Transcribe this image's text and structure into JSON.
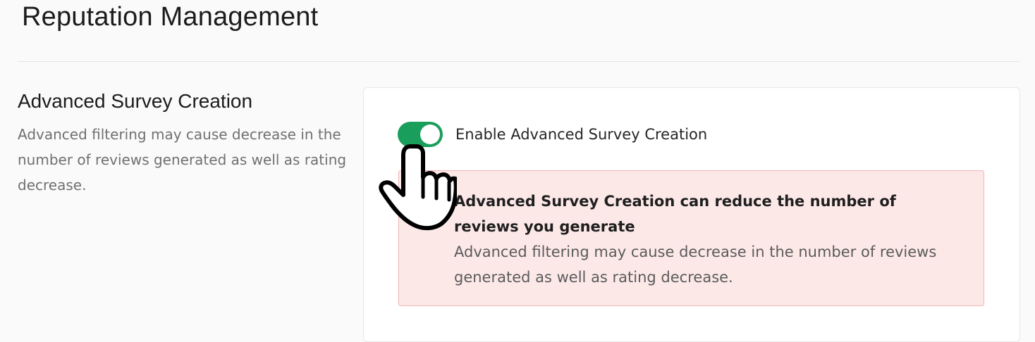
{
  "page": {
    "title": "Reputation Management"
  },
  "section": {
    "heading": "Advanced Survey Creation",
    "description": "Advanced filtering may cause decrease in the number of reviews generated as well as rating decrease."
  },
  "settings": {
    "toggle_label": "Enable Advanced Survey Creation",
    "toggle_on": true
  },
  "alert": {
    "title": "Advanced Survey Creation can reduce the number of reviews you generate",
    "body": "Advanced filtering may cause decrease in the number of reviews generated as well as rating decrease."
  },
  "colors": {
    "toggle_on": "#1a9e5c",
    "alert_background": "#fde8e8",
    "alert_border": "#f3b4b4"
  },
  "icons": {
    "cursor": "hand-pointer-icon"
  }
}
